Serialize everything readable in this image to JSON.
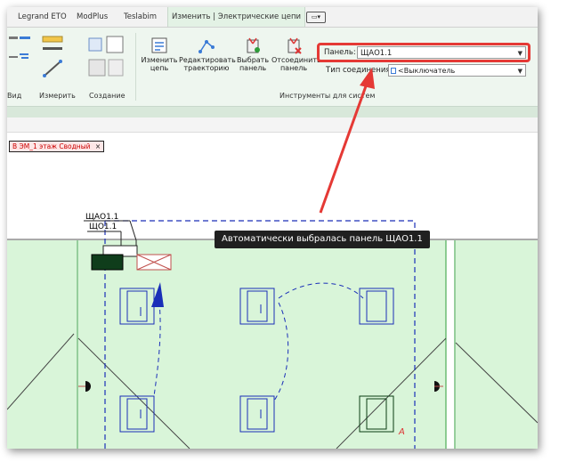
{
  "tabs": [
    {
      "label": "Legrand ETO",
      "active": false
    },
    {
      "label": "ModPlus",
      "active": false
    },
    {
      "label": "Teslabim",
      "active": false
    },
    {
      "label": "Изменить | Электрические цепи",
      "active": true
    }
  ],
  "ribbon": {
    "partial_group_label": "Вид",
    "measure_label": "Измерить",
    "create_label": "Создание",
    "edit_circuit": "Изменить цепь",
    "edit_circuit_l1": "Изменить",
    "edit_circuit_l2": "цепь",
    "edit_path_l1": "Редактировать",
    "edit_path_l2": "траекторию",
    "select_panel_l1": "Выбрать",
    "select_panel_l2": "панель",
    "disconnect_l1": "Отсоединить",
    "disconnect_l2": "панель",
    "tools_group_label": "Инструменты для систем",
    "panel_label": "Панель:",
    "panel_value": "ЩАО1.1",
    "connection_type_label": "Тип соединения:",
    "connection_type_value": "<Выключатель"
  },
  "view": {
    "tab_label": "В ЭМ_1 этаж Сводный",
    "close_symbol": "×",
    "panel_tag_1": "ЩАО1.1",
    "panel_tag_2": "ЩО1.1",
    "corner_mark": "А"
  },
  "callout": {
    "text": "Автоматически выбралась панель ЩАО1.1"
  },
  "colors": {
    "highlight": "#e53935",
    "room_fill": "#d9f5d9",
    "circuit_blue": "#1a2fb8",
    "callout_bg": "#202020"
  }
}
